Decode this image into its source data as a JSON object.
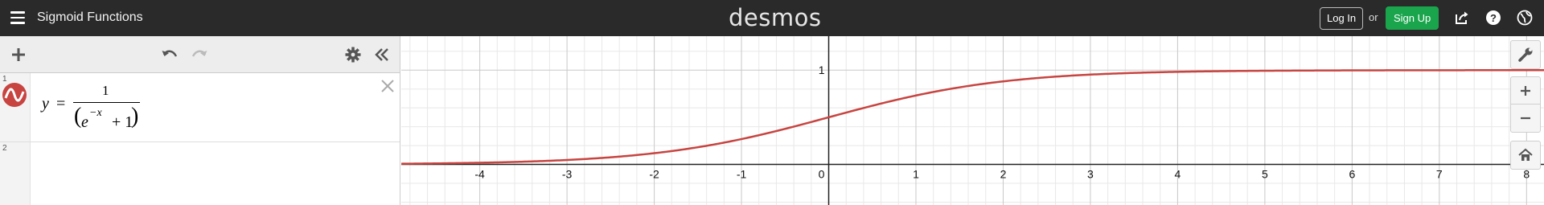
{
  "header": {
    "title": "Sigmoid Functions",
    "logo": "desmos",
    "login_label": "Log In",
    "or_label": "or",
    "signup_label": "Sign Up",
    "icons": [
      "menu-icon",
      "share-icon",
      "help-icon",
      "language-icon"
    ]
  },
  "expressions": {
    "toolbar_icons": [
      "add-icon",
      "undo-icon",
      "redo-icon",
      "settings-icon",
      "collapse-icon"
    ],
    "rows": [
      {
        "number": "1",
        "lhs": "y",
        "eq": "=",
        "numerator": "1",
        "base": "e",
        "exponent": "−x",
        "plus_term": "+ 1",
        "color": "#c74440",
        "icon": "graph-curve-icon"
      },
      {
        "number": "2"
      }
    ]
  },
  "graph": {
    "type": "line",
    "function": "y = 1 / (e^(-x) + 1)",
    "curve_color": "#c74440",
    "x_ticks": [
      "-4",
      "-3",
      "-2",
      "-1",
      "0",
      "1",
      "2",
      "3",
      "4",
      "5",
      "6",
      "7",
      "8"
    ],
    "y_ticks": [
      "1"
    ],
    "xlim": [
      -4.9,
      8.2
    ],
    "ylim": [
      -0.43,
      1.36
    ],
    "grid": true
  },
  "chart_data": {
    "type": "line",
    "series": [
      {
        "x": [
          -4.9,
          -4,
          -3,
          -2,
          -1,
          0,
          1,
          2,
          3,
          4,
          5,
          6,
          7,
          8.2
        ],
        "values": [
          0.007,
          0.018,
          0.047,
          0.119,
          0.269,
          0.5,
          0.731,
          0.881,
          0.953,
          0.982,
          0.993,
          0.998,
          0.999,
          1.0
        ]
      }
    ],
    "x_tick_labels": [
      "-4",
      "-3",
      "-2",
      "-1",
      "0",
      "1",
      "2",
      "3",
      "4",
      "5",
      "6",
      "7",
      "8"
    ],
    "y_tick_labels": [
      "1"
    ],
    "xlim": [
      -4.9,
      8.2
    ],
    "ylim": [
      -0.43,
      1.36
    ],
    "grid": true
  },
  "graph_controls": [
    "wrench-icon",
    "zoom-in-icon",
    "zoom-out-icon",
    "home-icon"
  ]
}
